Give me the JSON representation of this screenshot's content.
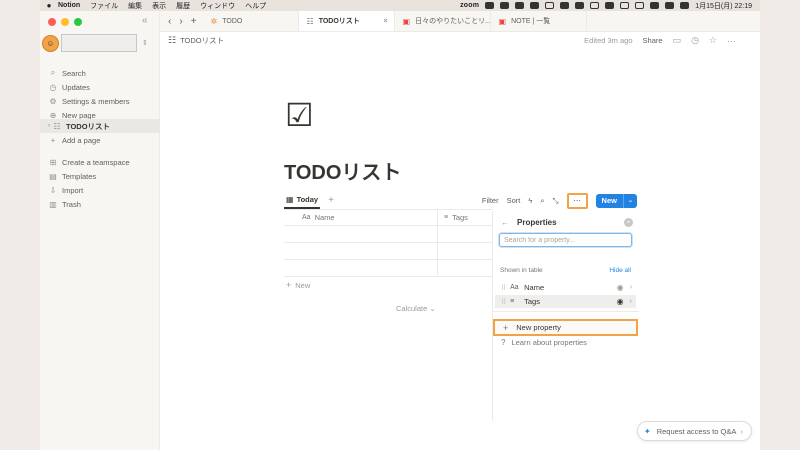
{
  "menubar": {
    "app": "Notion",
    "items": [
      "ファイル",
      "編集",
      "表示",
      "履歴",
      "ウィンドウ",
      "ヘルプ"
    ],
    "zoom": "zoom",
    "clock": "1月15日(月)  22:19"
  },
  "sidebar": {
    "items": [
      {
        "label": "Search",
        "icon": "search-icon"
      },
      {
        "label": "Updates",
        "icon": "clock-icon"
      },
      {
        "label": "Settings & members",
        "icon": "gear-icon"
      },
      {
        "label": "New page",
        "icon": "plus-circle-icon"
      }
    ],
    "page": {
      "label": "TODOリスト",
      "icon": "checklist-icon"
    },
    "add_page": "Add a page",
    "bottom_items": [
      {
        "label": "Create a teamspace",
        "icon": "teamspace-icon"
      },
      {
        "label": "Templates",
        "icon": "templates-icon"
      },
      {
        "label": "Import",
        "icon": "import-icon"
      },
      {
        "label": "Trash",
        "icon": "trash-icon"
      }
    ]
  },
  "tabs": [
    {
      "label": "TODO",
      "active": false
    },
    {
      "label": "TODOリスト",
      "active": true
    },
    {
      "label": "日々のやりたいことリ...",
      "active": false
    },
    {
      "label": "NOTE | 一覧",
      "active": false
    }
  ],
  "breadcrumb": "TODOリスト",
  "topright": {
    "edited": "Edited 3m ago",
    "share": "Share"
  },
  "page": {
    "title": "TODOリスト"
  },
  "viewbar": {
    "view_tab": "Today",
    "filter": "Filter",
    "sort": "Sort",
    "new": "New"
  },
  "table": {
    "columns": [
      {
        "label": "Name",
        "icon": "Aa"
      },
      {
        "label": "Tags",
        "icon": "≡"
      }
    ],
    "new_row": "New",
    "calculate": "Calculate"
  },
  "properties_panel": {
    "title": "Properties",
    "search_placeholder": "Search for a property...",
    "shown_label": "Shown in table",
    "hide_all": "Hide all",
    "props": [
      {
        "label": "Name",
        "icon": "Aa"
      },
      {
        "label": "Tags",
        "icon": "≡"
      }
    ],
    "new_property": "New property",
    "learn": "Learn about properties"
  },
  "qa": {
    "label": "Request access to Q&A"
  },
  "colors": {
    "accent": "#2383e2",
    "highlight": "#f0a347",
    "sidebar_bg": "#f7f6f3"
  }
}
